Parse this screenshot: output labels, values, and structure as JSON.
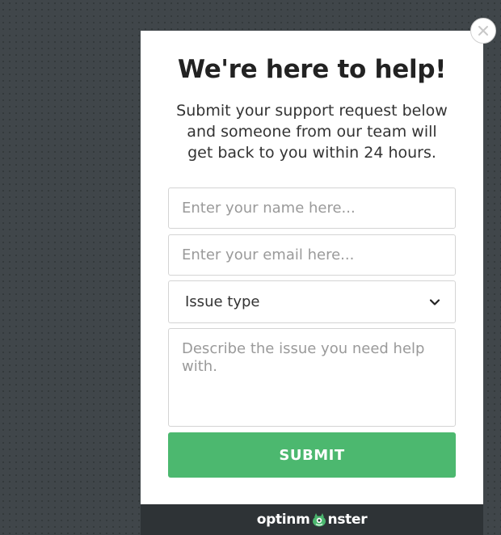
{
  "modal": {
    "title": "We're here to help!",
    "subtitle": "Submit your support request below and someone from our team will get back to you within 24 hours.",
    "name_placeholder": "Enter your name here...",
    "email_placeholder": "Enter your email here...",
    "issue_select_value": "Issue type",
    "description_placeholder": "Describe the issue you need help with.",
    "submit_label": "SUBMIT",
    "close_icon": "close-icon"
  },
  "footer": {
    "brand_before": "optinm",
    "brand_after": "nster",
    "logo_icon": "monster-logo-icon"
  },
  "colors": {
    "background": "#40464a",
    "submit": "#4cb86f",
    "footer": "#2e3336"
  }
}
